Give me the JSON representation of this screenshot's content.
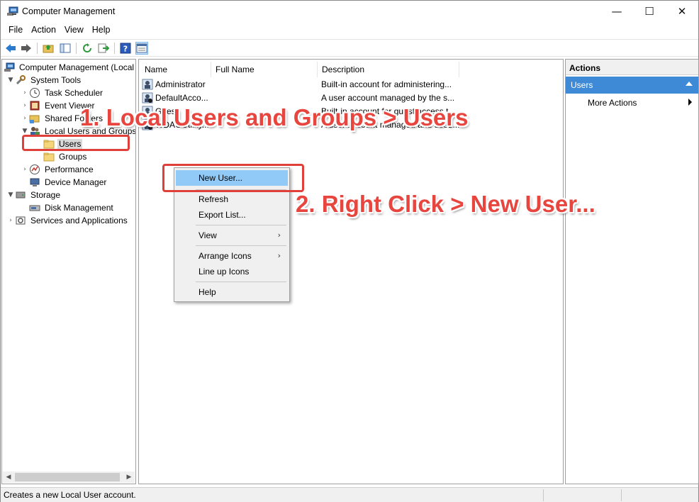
{
  "window": {
    "title": "Computer Management",
    "controls": {
      "minimize": "—",
      "maximize": "☐",
      "close": "✕"
    }
  },
  "menu": [
    "File",
    "Action",
    "View",
    "Help"
  ],
  "toolbar": {
    "icons": [
      "back-icon",
      "forward-icon",
      "up-folder-icon",
      "show-hide-tree-icon",
      "refresh-icon",
      "export-list-icon",
      "help-icon",
      "properties-icon"
    ]
  },
  "tree": {
    "root": "Computer Management (Local",
    "system_tools": "System Tools",
    "task_scheduler": "Task Scheduler",
    "event_viewer": "Event Viewer",
    "shared_folders": "Shared Folders",
    "local_users_groups": "Local Users and Groups",
    "users": "Users",
    "groups": "Groups",
    "performance": "Performance",
    "device_manager": "Device Manager",
    "storage": "Storage",
    "disk_management": "Disk Management",
    "services_apps": "Services and Applications"
  },
  "list": {
    "columns": [
      "Name",
      "Full Name",
      "Description"
    ],
    "rows": [
      {
        "name": "Administrator",
        "full_name": "",
        "description": "Built-in account for administering..."
      },
      {
        "name": "DefaultAcco...",
        "full_name": "",
        "description": "A user account managed by the s..."
      },
      {
        "name": "Guest",
        "full_name": "",
        "description": "Built-in account for guest access t..."
      },
      {
        "name": "WDAGUtility...",
        "full_name": "",
        "description": "A user account managed and used..."
      }
    ]
  },
  "actions": {
    "header": "Actions",
    "section": "Users",
    "more_actions": "More Actions"
  },
  "context_menu": {
    "new_user": "New User...",
    "refresh": "Refresh",
    "export_list": "Export List...",
    "view": "View",
    "arrange_icons": "Arrange Icons",
    "line_up_icons": "Line up Icons",
    "help": "Help"
  },
  "status_bar": {
    "text": "Creates a new Local User account."
  },
  "annotations": {
    "step1": "1. Local Users and Groups > Users",
    "step2": "2. Right Click > New User...",
    "color": "#e8453f"
  }
}
